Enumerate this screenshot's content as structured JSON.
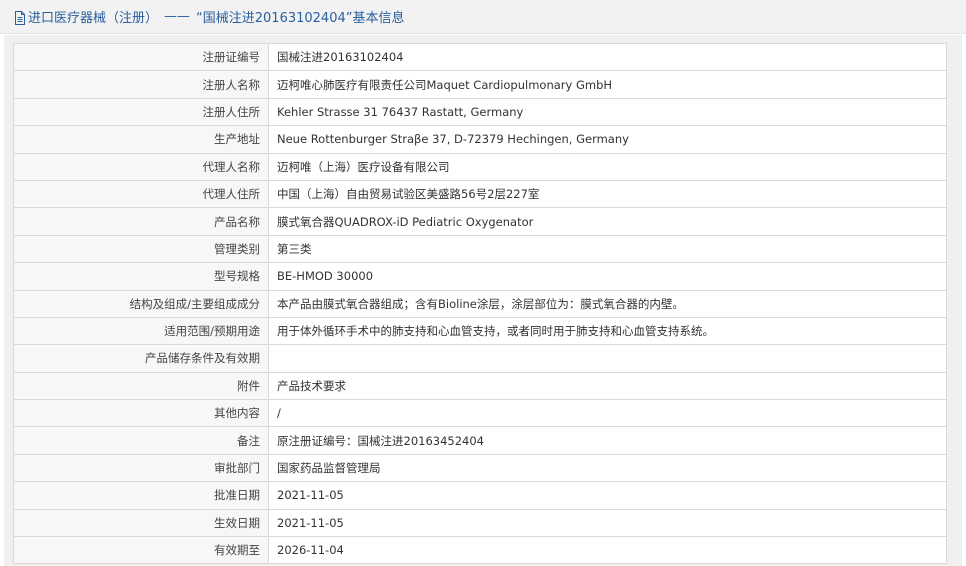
{
  "header": {
    "category": "进口医疗器械（注册）",
    "separator": "——",
    "title": "“国械注进20163102404”基本信息"
  },
  "fields": [
    {
      "label": "注册证编号",
      "value": "国械注进20163102404"
    },
    {
      "label": "注册人名称",
      "value": "迈柯唯心肺医疗有限责任公司Maquet Cardiopulmonary GmbH"
    },
    {
      "label": "注册人住所",
      "value": "Kehler Strasse 31 76437 Rastatt, Germany"
    },
    {
      "label": "生产地址",
      "value": "Neue Rottenburger Straβe 37, D-72379 Hechingen, Germany"
    },
    {
      "label": "代理人名称",
      "value": "迈柯唯（上海）医疗设备有限公司"
    },
    {
      "label": "代理人住所",
      "value": "中国（上海）自由贸易试验区美盛路56号2层227室"
    },
    {
      "label": "产品名称",
      "value": "膜式氧合器QUADROX-iD Pediatric Oxygenator"
    },
    {
      "label": "管理类别",
      "value": "第三类"
    },
    {
      "label": "型号规格",
      "value": "BE-HMOD 30000"
    },
    {
      "label": "结构及组成/主要组成成分",
      "value": "本产品由膜式氧合器组成；含有Bioline涂层，涂层部位为：膜式氧合器的内壁。"
    },
    {
      "label": "适用范围/预期用途",
      "value": "用于体外循环手术中的肺支持和心血管支持，或者同时用于肺支持和心血管支持系统。"
    },
    {
      "label": "产品储存条件及有效期",
      "value": ""
    },
    {
      "label": "附件",
      "value": "产品技术要求"
    },
    {
      "label": "其他内容",
      "value": "/"
    },
    {
      "label": "备注",
      "value": "原注册证编号：国械注进20163452404"
    },
    {
      "label": "审批部门",
      "value": "国家药品监督管理局"
    },
    {
      "label": "批准日期",
      "value": "2021-11-05"
    },
    {
      "label": "生效日期",
      "value": "2021-11-05"
    },
    {
      "label": "有效期至",
      "value": "2026-11-04"
    }
  ],
  "colors": {
    "header_text": "#2a5e9e",
    "label_bg": "#f7f7f7",
    "border": "#d9d9d9"
  },
  "icons": {
    "header": "document-icon"
  }
}
